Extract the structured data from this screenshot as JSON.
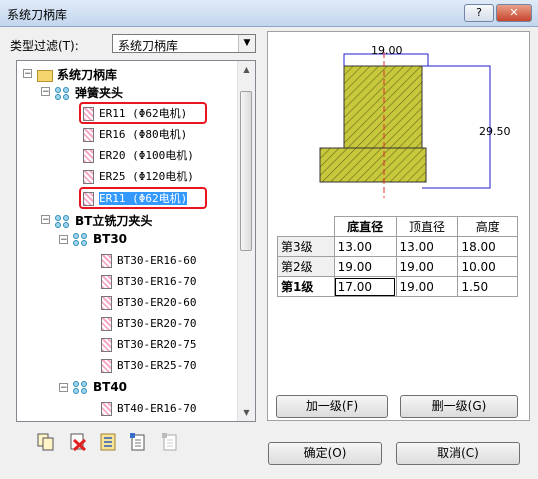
{
  "window": {
    "title": "系统刀柄库",
    "help_label": "?",
    "close_label": "✕"
  },
  "filter": {
    "label": "类型过滤(T):",
    "value": "系统刀柄库"
  },
  "tree": {
    "root": "系统刀柄库",
    "group1": "弹簧夹头",
    "er_items": [
      "ER11 (Φ62电机)",
      "ER16 (Φ80电机)",
      "ER20 (Φ100电机)",
      "ER25 (Φ120电机)",
      "ER11 (Φ62电机)"
    ],
    "group2": "BT立铣刀夹头",
    "bt30": "BT30",
    "bt30_items": [
      "BT30-ER16-60",
      "BT30-ER16-70",
      "BT30-ER20-60",
      "BT30-ER20-70",
      "BT30-ER20-75",
      "BT30-ER25-70"
    ],
    "bt40": "BT40",
    "bt40_items": [
      "BT40-ER16-70"
    ]
  },
  "preview": {
    "top_dim": "19.00",
    "height_dim": "29.50"
  },
  "grid": {
    "headers": [
      "底直径",
      "顶直径",
      "高度"
    ],
    "rows": [
      {
        "label": "第3级",
        "cells": [
          "13.00",
          "13.00",
          "18.00"
        ]
      },
      {
        "label": "第2级",
        "cells": [
          "19.00",
          "19.00",
          "10.00"
        ]
      },
      {
        "label": "第1级",
        "cells": [
          "17.00",
          "19.00",
          "1.50"
        ]
      }
    ]
  },
  "buttons": {
    "add_level": "加一级(F)",
    "delete_level": "删一级(G)",
    "ok": "确定(O)",
    "cancel": "取消(C)"
  },
  "colors": {
    "accent": "#3399ff",
    "selection_outline": "#e8151f",
    "hatch": "#c8c83c",
    "dimension": "#1f1fd0"
  }
}
